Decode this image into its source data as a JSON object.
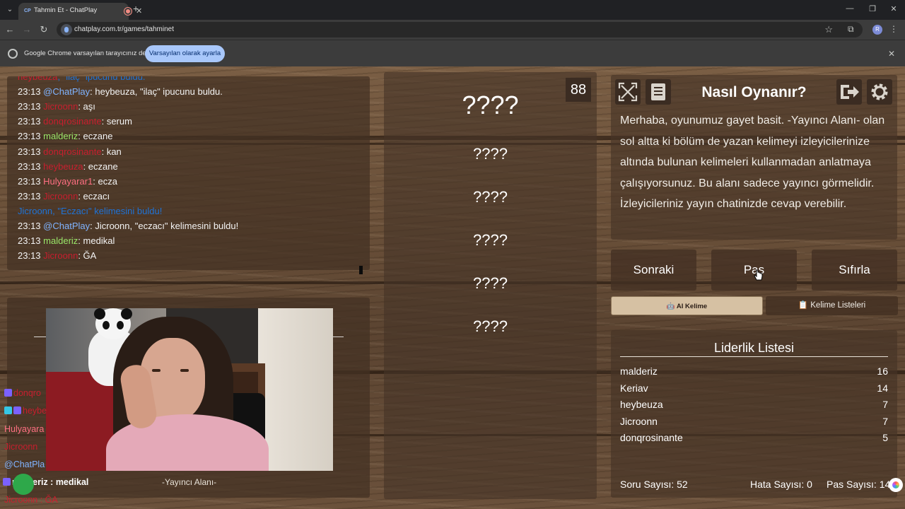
{
  "browser": {
    "tab_title": "Tahmin Et - ChatPlay",
    "tab_favicon": "CP",
    "url": "chatplay.com.tr/games/tahminet",
    "profile_initial": "R",
    "infobar_text": "Google Chrome varsayılan tarayıcınız değil",
    "infobar_button": "Varsayılan olarak ayarla"
  },
  "chat": {
    "lines": [
      {
        "time": "",
        "user": "heybeuza",
        "text": ", \"ilaç\" ipucunu buldu.",
        "kind": "system-partial"
      },
      {
        "time": "23:13",
        "user": "@ChatPlay",
        "sep": ": ",
        "text": "heybeuza, \"ilaç\" ipucunu buldu.",
        "ucolor": "blue"
      },
      {
        "time": "23:13",
        "user": "Jicroonn",
        "sep": ": ",
        "text": "aşı",
        "ucolor": "red"
      },
      {
        "time": "23:13",
        "user": "donqrosinante",
        "sep": ": ",
        "text": "serum",
        "ucolor": "red"
      },
      {
        "time": "23:13",
        "user": "malderiz",
        "sep": ": ",
        "text": "eczane",
        "ucolor": "green"
      },
      {
        "time": "23:13",
        "user": "donqrosinante",
        "sep": ": ",
        "text": "kan",
        "ucolor": "red"
      },
      {
        "time": "23:13",
        "user": "heybeuza",
        "sep": ": ",
        "text": "eczane",
        "ucolor": "red"
      },
      {
        "time": "23:13",
        "user": "Hulyayarar1",
        "sep": ": ",
        "text": "ecza",
        "ucolor": "pink"
      },
      {
        "time": "23:13",
        "user": "Jicroonn",
        "sep": ": ",
        "text": "eczacı",
        "ucolor": "red"
      },
      {
        "time": "",
        "user": "",
        "sep": "",
        "text": "Jicroonn, \"Eczacı\" kelimesini buldu!",
        "kind": "system"
      },
      {
        "time": "23:13",
        "user": "@ChatPlay",
        "sep": ": ",
        "text": "Jicroonn, \"eczacı\" kelimesini buldu!",
        "ucolor": "blue"
      },
      {
        "time": "23:13",
        "user": "malderiz",
        "sep": ": ",
        "text": "medikal",
        "ucolor": "green"
      },
      {
        "time": "23:13",
        "user": "Jicroonn",
        "sep": ": ",
        "text": "ĞA",
        "ucolor": "red"
      }
    ]
  },
  "streamer": {
    "label": "-Yayıncı Alanı-",
    "overlay": [
      {
        "text": "donqro",
        "ucolor": "red",
        "badges": 1
      },
      {
        "text": "heybe",
        "ucolor": "red",
        "badges": 2
      },
      {
        "text": "Hulyayara",
        "ucolor": "pink",
        "badges": 0
      },
      {
        "text": "Jicroonn",
        "ucolor": "red",
        "badges": 0
      },
      {
        "text": "@ChatPla",
        "ucolor": "blue",
        "badges": 0
      },
      {
        "text": "malderiz : medikal",
        "ucolor": "white",
        "badges": 1
      },
      {
        "text": "Jicroonn : ĞA",
        "ucolor": "red",
        "badges": 0
      }
    ]
  },
  "game": {
    "counter": "88",
    "main_word": "????",
    "hints": [
      "????",
      "????",
      "????",
      "????",
      "????"
    ]
  },
  "howto": {
    "title": "Nasıl Oynanır?",
    "text": "Merhaba, oyunumuz gayet basit. -Yayıncı Alanı- olan sol altta ki bölüm de yazan kelimeyi izleyicilerinize altında bulunan kelimeleri kullanmadan anlatmaya çalışıyorsunuz. Bu alanı sadece yayıncı görmelidir. İzleyicileriniz yayın chatinizde cevap verebilir.",
    "icons": [
      "fullscreen-icon",
      "notes-icon",
      "logout-icon",
      "settings-icon"
    ]
  },
  "controls": {
    "next": "Sonraki",
    "pass": "Pas",
    "reset": "Sıfırla",
    "ai_word": "AI Kelime",
    "word_lists": "Kelime Listeleri"
  },
  "leaderboard": {
    "title": "Liderlik Listesi",
    "rows": [
      {
        "name": "malderiz",
        "score": "16"
      },
      {
        "name": "Keriav",
        "score": "14"
      },
      {
        "name": "heybeuza",
        "score": "7"
      },
      {
        "name": "Jicroonn",
        "score": "7"
      },
      {
        "name": "donqrosinante",
        "score": "5"
      }
    ]
  },
  "stats": {
    "questions": "Soru Sayısı: 52",
    "errors": "Hata Sayısı: 0",
    "passes": "Pas Sayısı: 14"
  },
  "colors": {
    "system_message": "#1f73d6",
    "user_red": "#c81e2e",
    "user_green": "#9be86a",
    "user_blue": "#7fb3ff",
    "user_pink": "#ff6f82"
  }
}
